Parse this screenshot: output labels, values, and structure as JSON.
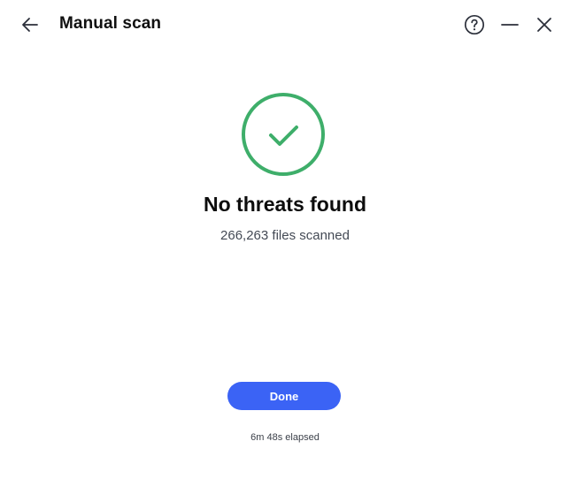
{
  "header": {
    "title": "Manual scan"
  },
  "icons": {
    "back": "arrow-left-icon",
    "help": "question-circle-icon",
    "minimize": "minimize-icon",
    "close": "close-icon",
    "status": "check-circle-icon"
  },
  "result": {
    "headline": "No threats found",
    "files_scanned": "266,263 files scanned",
    "elapsed": "6m 48s elapsed"
  },
  "actions": {
    "done_label": "Done"
  },
  "colors": {
    "accent": "#3b63f5",
    "success": "#3eae6a",
    "icon": "#2b2f3a"
  }
}
